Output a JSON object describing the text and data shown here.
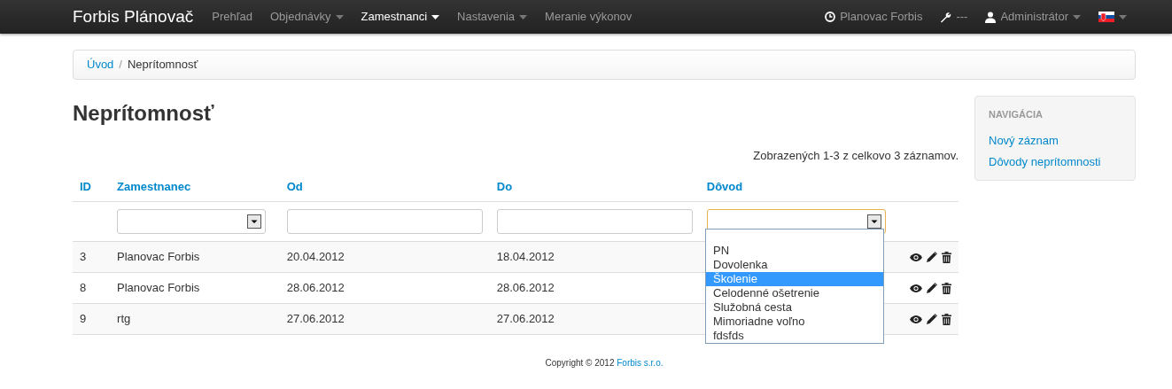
{
  "navbar": {
    "brand": "Forbis Plánovač",
    "items": [
      {
        "label": "Prehľad",
        "selected": false,
        "dropdown": false
      },
      {
        "label": "Objednávky",
        "selected": false,
        "dropdown": true
      },
      {
        "label": "Zamestnanci",
        "selected": true,
        "dropdown": true
      },
      {
        "label": "Nastavenia",
        "selected": false,
        "dropdown": true
      },
      {
        "label": "Meranie výkonov",
        "selected": false,
        "dropdown": false
      }
    ],
    "right": [
      {
        "kind": "clock",
        "label": "Planovac Forbis",
        "dropdown": false
      },
      {
        "kind": "wrench",
        "label": "---",
        "dropdown": false
      },
      {
        "kind": "user",
        "label": "Administrátor",
        "dropdown": true
      },
      {
        "kind": "flag",
        "dropdown": true
      }
    ]
  },
  "breadcrumb": {
    "separator": "/",
    "items": [
      {
        "label": "Úvod",
        "link": true
      },
      {
        "label": "Neprítomnosť",
        "link": false
      }
    ]
  },
  "title": "Neprítomnosť",
  "summary": "Zobrazených 1-3 z celkovo 3 záznamov.",
  "table": {
    "columns": [
      {
        "label": "ID",
        "kind": "plain"
      },
      {
        "label": "Zamestnanec",
        "kind": "select"
      },
      {
        "label": "Od",
        "kind": "text"
      },
      {
        "label": "Do",
        "kind": "text"
      },
      {
        "label": "Dôvod",
        "kind": "select"
      }
    ],
    "rows": [
      {
        "cells": [
          "3",
          "Planovac Forbis",
          "20.04.2012",
          "18.04.2012"
        ]
      },
      {
        "cells": [
          "8",
          "Planovac Forbis",
          "28.06.2012",
          "28.06.2012"
        ]
      },
      {
        "cells": [
          "9",
          "rtg",
          "27.06.2012",
          "27.06.2012"
        ]
      }
    ]
  },
  "reason_dropdown": {
    "options": [
      {
        "label": "PN",
        "selected": false
      },
      {
        "label": "Dovolenka",
        "selected": false
      },
      {
        "label": "Školenie",
        "selected": true
      },
      {
        "label": "Celodenné ošetrenie",
        "selected": false
      },
      {
        "label": "Služobná cesta",
        "selected": false
      },
      {
        "label": "Mimoriadne voľno",
        "selected": false
      },
      {
        "label": "fdsfds",
        "selected": false
      }
    ]
  },
  "sidebar": {
    "heading": "NAVIGÁCIA",
    "links": [
      "Nový záznam",
      "Dôvody neprítomnosti"
    ]
  },
  "footer": {
    "text": "Copyright © 2012 ",
    "link": "Forbis s.r.o."
  }
}
